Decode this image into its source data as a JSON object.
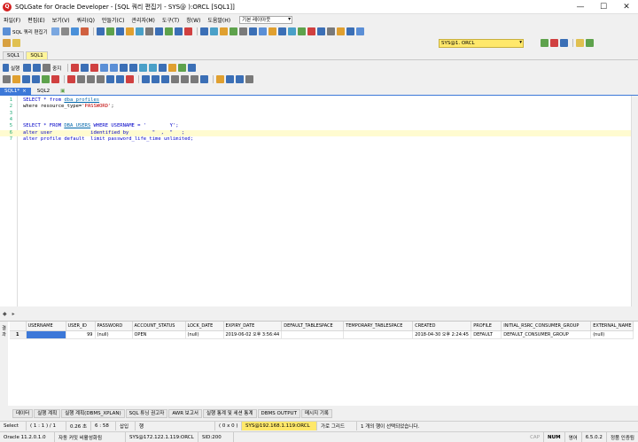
{
  "window": {
    "title": "SQLGate for Oracle Developer - [SQL 쿼리 편집기 - SYS@                    ):ORCL [SQL1]]",
    "minimize": "—",
    "maximize": "☐",
    "close": "✕"
  },
  "menu": {
    "items": [
      "파일(F)",
      "편집(E)",
      "보기(V)",
      "쿼리(Q)",
      "만들기(C)",
      "관리자(M)",
      "도구(T)",
      "창(W)",
      "도움말(H)"
    ],
    "layout_select": "기본 레이아웃"
  },
  "toolbar1": {
    "sql_editor_label": "SQL 쿼리 편집기"
  },
  "connection": {
    "selected": "SYS@1.          ORCL"
  },
  "session_tabs": [
    "SQL1",
    "SQL1"
  ],
  "toolbar3": {
    "execute_label": "실행",
    "stop_label": "중지"
  },
  "editor_tabs": [
    {
      "label": "SQL1*",
      "close": "×"
    },
    {
      "label": "SQL2"
    }
  ],
  "editor": {
    "lines": [
      {
        "n": "1",
        "a": "SELECT * from ",
        "b": "dba_profiles",
        "c": ""
      },
      {
        "n": "2",
        "a": "where resource_type=",
        "b": "'PASSWORD'",
        "c": ";"
      },
      {
        "n": "3",
        "a": "",
        "b": "",
        "c": ""
      },
      {
        "n": "4",
        "a": "",
        "b": "",
        "c": ""
      },
      {
        "n": "5",
        "a": "SELECT * FROM ",
        "b": "DBA_USERS",
        "c": " WHERE USERNAME = '        Y';"
      },
      {
        "n": "6",
        "a": "alter user ",
        "b": "           ",
        "c": " identified by        \"  ,  \"   ;"
      },
      {
        "n": "7",
        "a": "alter profile default  limit password_life_time unlimited;",
        "b": "",
        "c": ""
      }
    ]
  },
  "results": {
    "side_label": "결과",
    "columns": [
      "",
      "USERNAME",
      "USER_ID",
      "PASSWORD",
      "ACCOUNT_STATUS",
      "LOCK_DATE",
      "EXPIRY_DATE",
      "DEFAULT_TABLESPACE",
      "TEMPORARY_TABLESPACE",
      "CREATED",
      "PROFILE",
      "INITIAL_RSRC_CONSUMER_GROUP",
      "EXTERNAL_NAME"
    ],
    "rows": [
      [
        "1",
        "",
        "99",
        "(null)",
        "OPEN",
        "(null)",
        "2019-06-02 오후 3:56:44",
        "",
        "",
        "2018-04-30 오후 2:24:45",
        "DEFAULT",
        "DEFAULT_CONSUMER_GROUP",
        "(null)"
      ]
    ]
  },
  "result_tabs": [
    "데이터",
    "실행 계획",
    "실행 계획(DBMS_XPLAN)",
    "SQL 튜닝 권고자",
    "AWR 보고서",
    "실행 통계 및 세션 통계",
    "DBMS OUTPUT",
    "메시지 기록"
  ],
  "status1": {
    "mode": "Select",
    "position": "( 1 : 1 ) / 1",
    "time": "0.26 초",
    "cursor": "6 : 58",
    "insert": "삽입",
    "row": "행",
    "offset": "( 0 x 0 )",
    "connection": "SYS@192.168.1.119:ORCL",
    "grid": "가로 그리드",
    "message": "1 개의 행이 선택되었습니다."
  },
  "status2": {
    "version": "Oracle 11.2.0.1.0",
    "autocommit": "자동 커밋 비활성화됨",
    "connection": "SYS@172.122.1.119:ORCL",
    "sid": "SID:200",
    "caps": "CAP",
    "num": "NUM",
    "lang": "영어",
    "app_version": "6.5.0.2",
    "license": "정품 인증됨"
  }
}
